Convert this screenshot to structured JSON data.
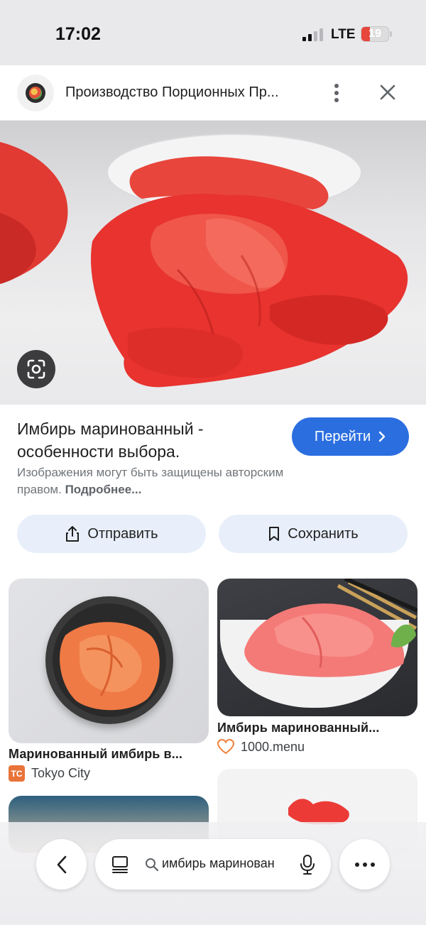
{
  "status": {
    "time": "17:02",
    "network": "LTE",
    "battery": "19"
  },
  "header": {
    "title": "Производство Порционных Пр..."
  },
  "result": {
    "title": "Имбирь маринованный - особенности выбора.",
    "visit_label": "Перейти",
    "copyright_note": "Изображения могут быть защищены авторским правом.",
    "more_link": "Подробнее..."
  },
  "actions": {
    "share": "Отправить",
    "save": "Сохранить"
  },
  "related": [
    {
      "title": "Маринованный имбирь в...",
      "source": "Tokyo City",
      "badge": "TC"
    },
    {
      "title": "Имбирь маринованный...",
      "source": "1000.menu"
    }
  ],
  "bottom_bar": {
    "search_query": "имбирь маринован"
  },
  "colors": {
    "accent": "#2b6ee0",
    "chip_bg": "#e8effb",
    "ginger": "#e8332f",
    "battery_low": "#e8453c"
  }
}
